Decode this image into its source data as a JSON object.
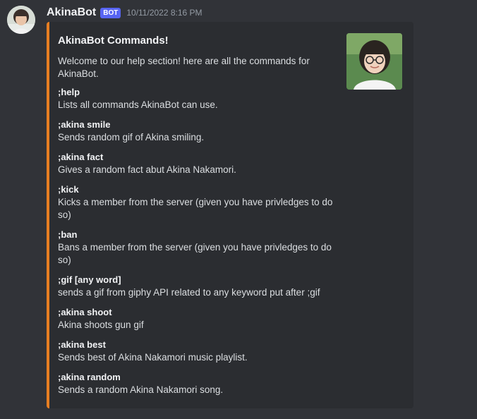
{
  "message": {
    "username": "AkinaBot",
    "bot_tag": "BOT",
    "timestamp": "10/11/2022 8:16 PM"
  },
  "embed": {
    "accent_color": "#e67e22",
    "title": "AkinaBot Commands!",
    "description": "Welcome to our help section! here are all the commands for AkinaBot.",
    "fields": [
      {
        "name": ";help",
        "value": "Lists all commands AkinaBot can use."
      },
      {
        "name": ";akina smile",
        "value": "Sends random gif of Akina smiling."
      },
      {
        "name": ";akina fact",
        "value": "Gives a random fact abut Akina Nakamori."
      },
      {
        "name": ";kick",
        "value": "Kicks a member from the server (given you have privledges to do so)"
      },
      {
        "name": ";ban",
        "value": "Bans a member from the server (given you have privledges to do so)"
      },
      {
        "name": ";gif [any word]",
        "value": "sends a gif from giphy API related to any keyword put after ;gif"
      },
      {
        "name": ";akina shoot",
        "value": "Akina shoots gun gif"
      },
      {
        "name": ";akina best",
        "value": "Sends best of Akina Nakamori music playlist."
      },
      {
        "name": ";akina random",
        "value": "Sends a random Akina Nakamori song."
      }
    ]
  }
}
